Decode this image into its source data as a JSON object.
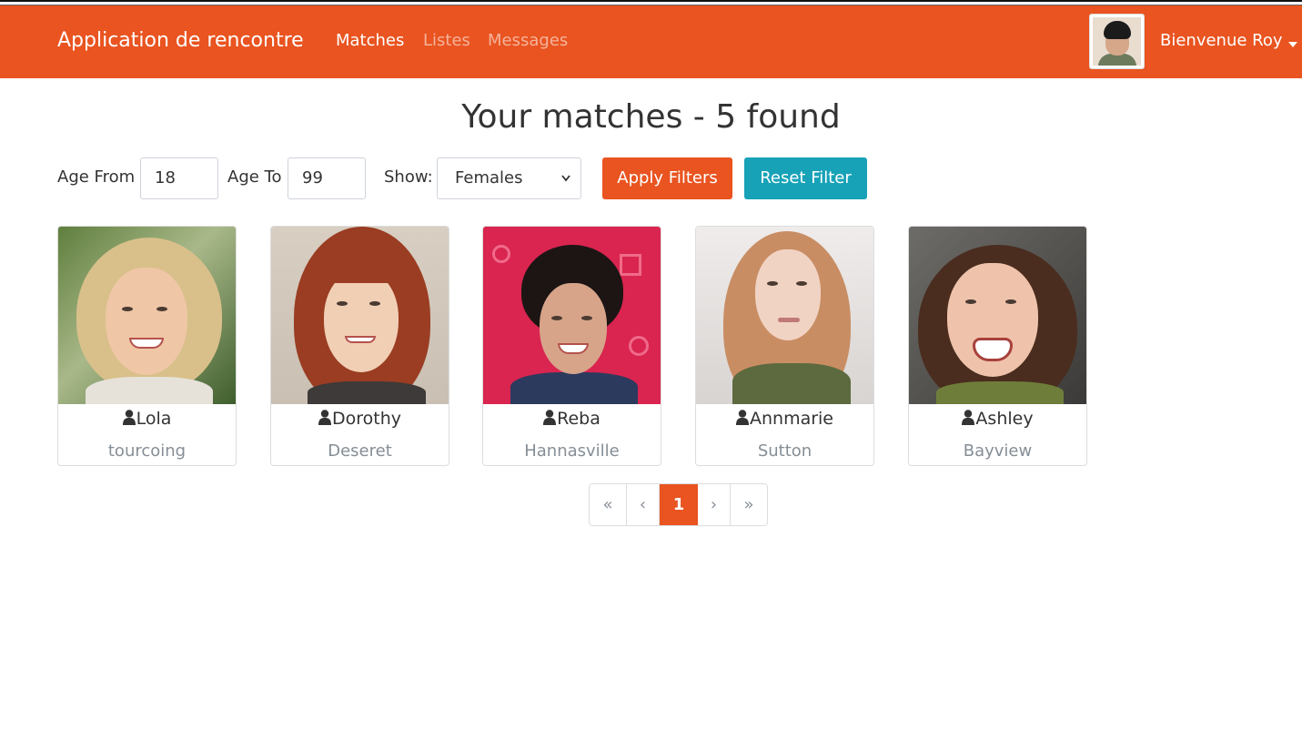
{
  "navbar": {
    "brand": "Application de rencontre",
    "links": [
      {
        "label": "Matches",
        "active": true
      },
      {
        "label": "Listes",
        "active": false
      },
      {
        "label": "Messages",
        "active": false
      }
    ],
    "welcome": "Bienvenue Roy",
    "brand_color": "#e95420"
  },
  "main": {
    "title": "Your matches - 5 found"
  },
  "filters": {
    "age_from_label": "Age From",
    "age_from_value": "18",
    "age_to_label": "Age To",
    "age_to_value": "99",
    "show_label": "Show:",
    "show_value": "Females",
    "apply_label": "Apply Filters",
    "reset_label": "Reset Filter",
    "apply_color": "#e95420",
    "reset_color": "#17a2b8"
  },
  "members": [
    {
      "name": "Lola",
      "city": "tourcoing"
    },
    {
      "name": "Dorothy",
      "city": "Deseret"
    },
    {
      "name": "Reba",
      "city": "Hannasville"
    },
    {
      "name": "Annmarie",
      "city": "Sutton"
    },
    {
      "name": "Ashley",
      "city": "Bayview"
    }
  ],
  "pagination": {
    "first": "«",
    "prev": "‹",
    "current": "1",
    "next": "›",
    "last": "»"
  },
  "icons": {
    "member_icon": "user-icon",
    "dropdown_icon": "caret-down-icon",
    "select_icon": "chevron-down-icon"
  }
}
